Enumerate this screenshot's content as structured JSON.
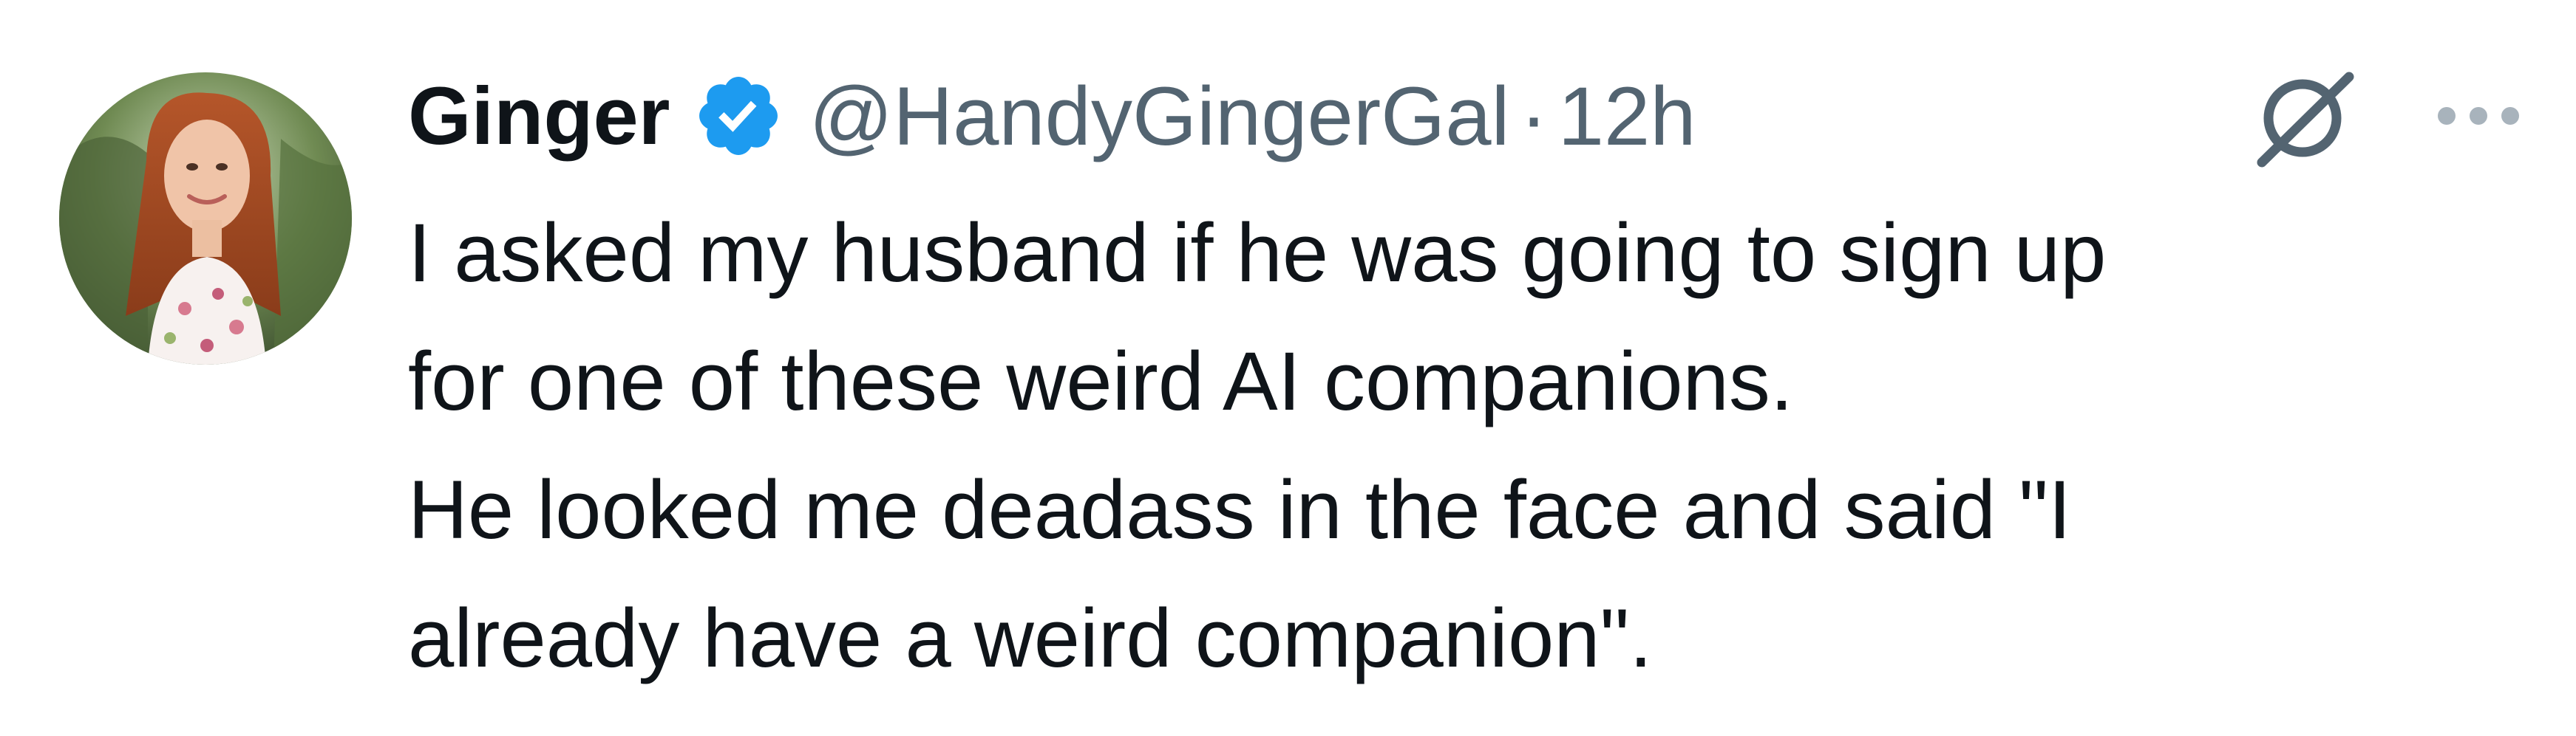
{
  "author": {
    "display_name": "Ginger",
    "handle": "@HandyGingerGal",
    "separator": "·",
    "timestamp": "12h",
    "verified_color": "#1d9bf0"
  },
  "icons": {
    "avatar": "profile-photo",
    "verified": "verified-badge-icon",
    "grok": "grok-icon",
    "more": "more-options-icon"
  },
  "tweet": {
    "lines": [
      "I asked my husband if he was going to sign up",
      "for one of these weird AI companions.",
      "He looked me deadass in the face and said \"I",
      "already have a weird companion\"."
    ]
  },
  "colors": {
    "text_primary": "#0f1419",
    "text_secondary": "#536471",
    "background": "#ffffff"
  }
}
